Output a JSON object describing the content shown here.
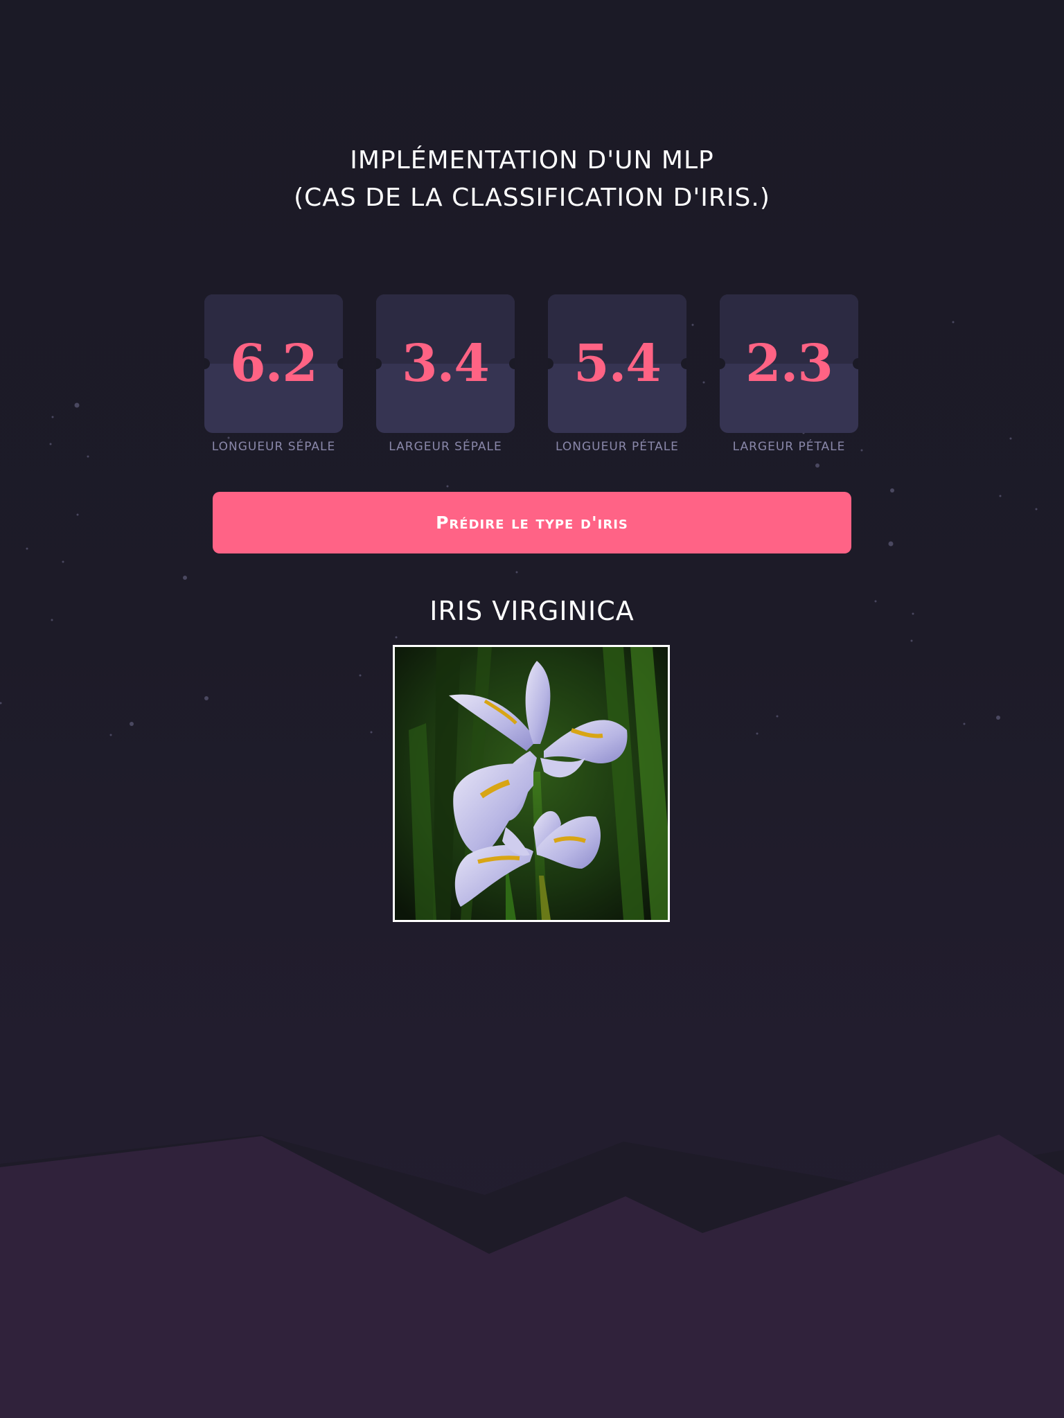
{
  "header": {
    "title_line1": "IMPLÉMENTATION D'UN MLP",
    "title_line2": "(CAS DE LA CLASSIFICATION D'IRIS.)"
  },
  "inputs": [
    {
      "value": "6.2",
      "label": "LONGUEUR SÉPALE"
    },
    {
      "value": "3.4",
      "label": "LARGEUR SÉPALE"
    },
    {
      "value": "5.4",
      "label": "LONGUEUR PÉTALE"
    },
    {
      "value": "2.3",
      "label": "LARGEUR PÉTALE"
    }
  ],
  "predict_button": {
    "label": "Prédire le type d'iris"
  },
  "result": {
    "label": "IRIS VIRGINICA",
    "image_icon": "iris-flower-photo"
  },
  "colors": {
    "accent": "#ff6386",
    "background": "#1b1a26",
    "card_bg": "#363452",
    "label": "#8a88aa",
    "mountain": "#30223b"
  }
}
